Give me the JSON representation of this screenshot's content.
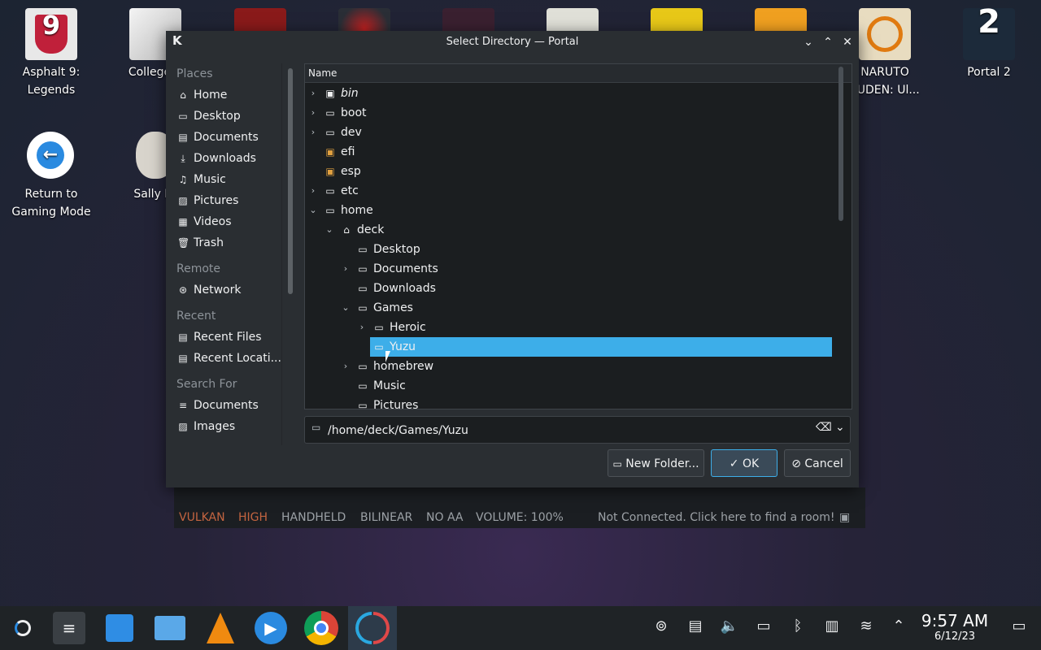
{
  "desktop": {
    "icons": [
      {
        "label": "Asphalt 9:\nLegends",
        "line1": "Asphalt 9:",
        "line2": "Legends"
      },
      {
        "label": "College B",
        "line1": "College B",
        "line2": ""
      },
      {
        "label": "Return to Gaming Mode",
        "line1": "Return to",
        "line2": "Gaming Mode"
      },
      {
        "label": "Sally Fa",
        "line1": "Sally Fa",
        "line2": ""
      },
      {
        "label": "NARUTO SHIPPUDEN: Ul...",
        "line1": "NARUTO",
        "line2": "PUDEN: Ul..."
      },
      {
        "label": "Portal 2",
        "line1": "Portal 2",
        "line2": ""
      }
    ]
  },
  "dialog": {
    "title": "Select Directory — Portal",
    "places": {
      "places_header": "Places",
      "places_items": [
        "Home",
        "Desktop",
        "Documents",
        "Downloads",
        "Music",
        "Pictures",
        "Videos",
        "Trash"
      ],
      "remote_header": "Remote",
      "remote_items": [
        "Network"
      ],
      "recent_header": "Recent",
      "recent_items": [
        "Recent Files",
        "Recent Locati..."
      ],
      "search_header": "Search For",
      "search_items": [
        "Documents",
        "Images"
      ]
    },
    "tree": {
      "column_header": "Name",
      "rows": [
        "bin",
        "boot",
        "dev",
        "efi",
        "esp",
        "etc",
        "home",
        "deck",
        "Desktop",
        "Documents",
        "Downloads",
        "Games",
        "Heroic",
        "Yuzu",
        "homebrew",
        "Music",
        "Pictures"
      ],
      "selected": "Yuzu"
    },
    "path_value": "/home/deck/Games/Yuzu",
    "buttons": {
      "new_folder": "New Folder...",
      "ok": "OK",
      "cancel": "Cancel"
    }
  },
  "emulator_status": {
    "items": [
      "VULKAN",
      "HIGH",
      "HANDHELD",
      "BILINEAR",
      "NO AA",
      "VOLUME: 100%"
    ],
    "network": "Not Connected. Click here to find a room!"
  },
  "taskbar": {
    "time": "9:57 AM",
    "date": "6/12/23"
  },
  "colors": {
    "selection": "#3daee9",
    "status_vulkan": "#c36440",
    "status_high": "#c36440"
  }
}
